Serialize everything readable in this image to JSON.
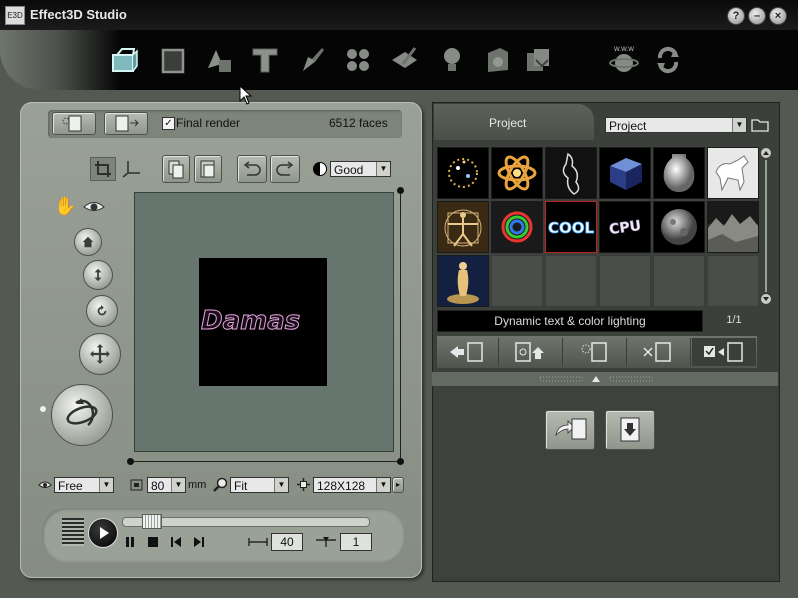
{
  "window": {
    "title": "Effect3D Studio",
    "icon_text": "E3D",
    "controls": [
      "?",
      "–",
      "×"
    ]
  },
  "toolbar": {
    "tools": [
      "object-icon",
      "frame-icon",
      "shapes-icon",
      "text-3d-icon",
      "material-icon",
      "particles-icon",
      "paint-icon",
      "light-icon",
      "settings-icon",
      "import-icon",
      "web-icon",
      "refresh-icon"
    ]
  },
  "left": {
    "final_render_label": "Final render",
    "final_render_checked": true,
    "faces": "6512 faces",
    "quality": "Good",
    "render_text": "Damas",
    "view_mode": "Free",
    "size_value": "80",
    "size_unit": "mm",
    "zoom": "Fit",
    "resolution": "128X128",
    "play": {
      "frames": "40",
      "step": "1",
      "position": 0.08
    }
  },
  "right": {
    "tab_label": "Project",
    "category_select": "Project",
    "description": "Dynamic text & color lighting",
    "page": "1/1",
    "thumbnails": [
      "sparkle-ring",
      "atom",
      "figure-sketch",
      "blue-cube",
      "silver-vase",
      "white-horse",
      "vitruvian-man",
      "rainbow-ring",
      "cool-text",
      "cpu-text",
      "moon-sphere",
      "rocky-landscape",
      "venus-statue"
    ]
  },
  "colors": {
    "panel": "#9aa196",
    "right_panel": "#3c403b",
    "titlebar": "#0a0a0a"
  }
}
